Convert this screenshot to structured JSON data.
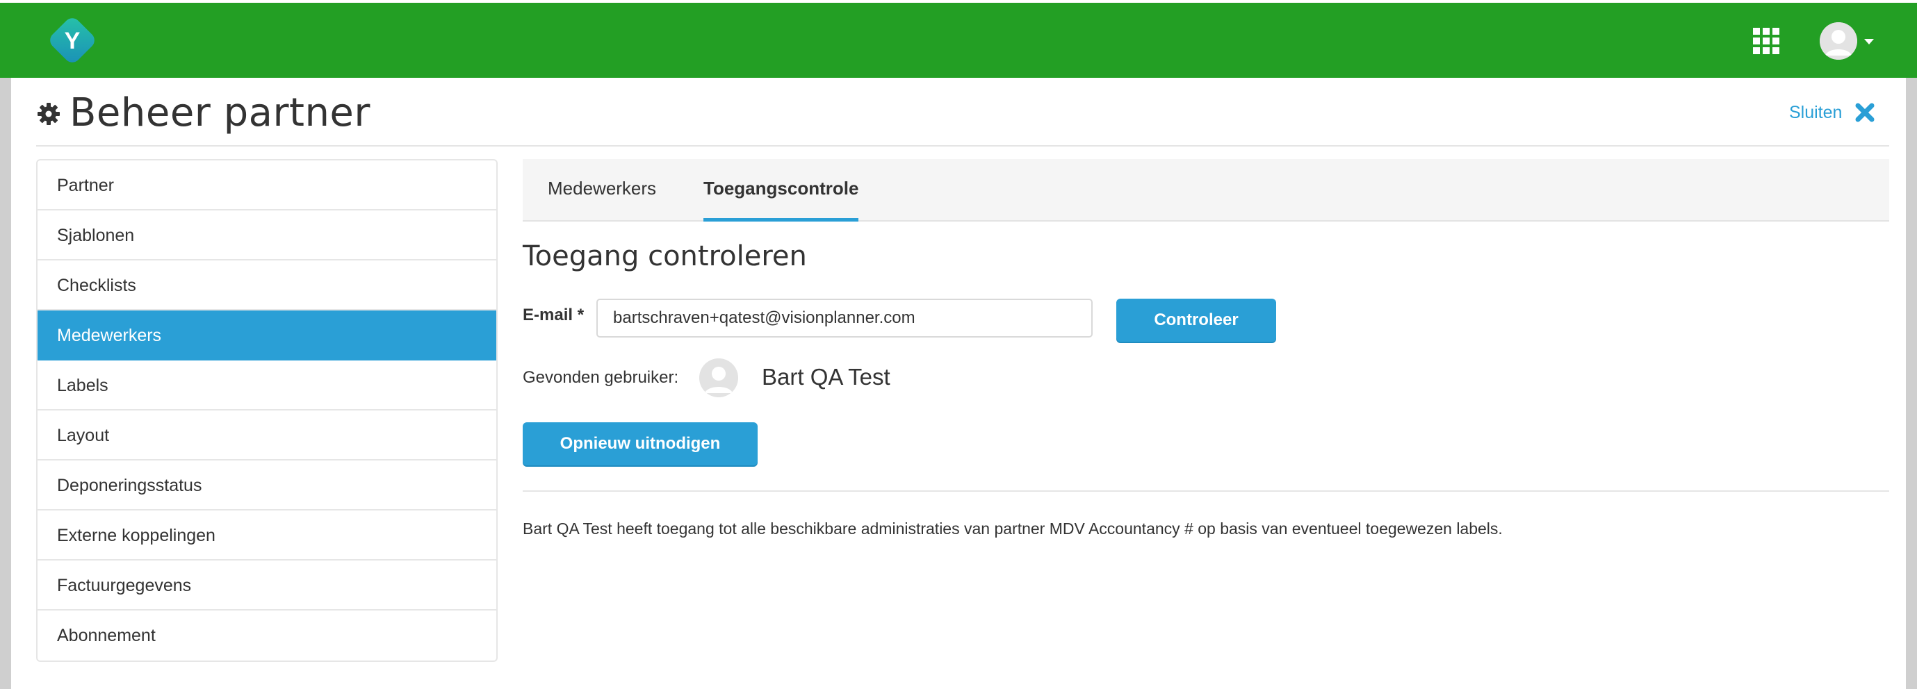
{
  "header": {
    "logo_letter": "Y",
    "apps_icon": "grid-icon",
    "user_icon": "user-avatar-icon"
  },
  "page": {
    "title": "Beheer partner",
    "close_label": "Sluiten"
  },
  "sidebar": {
    "items": [
      {
        "label": "Partner",
        "active": false
      },
      {
        "label": "Sjablonen",
        "active": false
      },
      {
        "label": "Checklists",
        "active": false
      },
      {
        "label": "Medewerkers",
        "active": true
      },
      {
        "label": "Labels",
        "active": false
      },
      {
        "label": "Layout",
        "active": false
      },
      {
        "label": "Deponeringsstatus",
        "active": false
      },
      {
        "label": "Externe koppelingen",
        "active": false
      },
      {
        "label": "Factuurgegevens",
        "active": false
      },
      {
        "label": "Abonnement",
        "active": false
      }
    ]
  },
  "tabs": [
    {
      "label": "Medewerkers",
      "active": false
    },
    {
      "label": "Toegangscontrole",
      "active": true
    }
  ],
  "main": {
    "section_title": "Toegang controleren",
    "email_label": "E-mail *",
    "email_value": "bartschraven+qatest@visionplanner.com",
    "check_button": "Controleer",
    "found_label": "Gevonden gebruiker:",
    "found_name": "Bart QA Test",
    "reinvite_button": "Opnieuw uitnodigen",
    "info_text": "Bart QA Test heeft toegang tot alle beschikbare administraties van partner MDV Accountancy # op basis van eventueel toegewezen labels."
  },
  "colors": {
    "header_green": "#239f24",
    "accent_blue": "#2a9fd6",
    "logo_teal": "#1fb3a6"
  }
}
